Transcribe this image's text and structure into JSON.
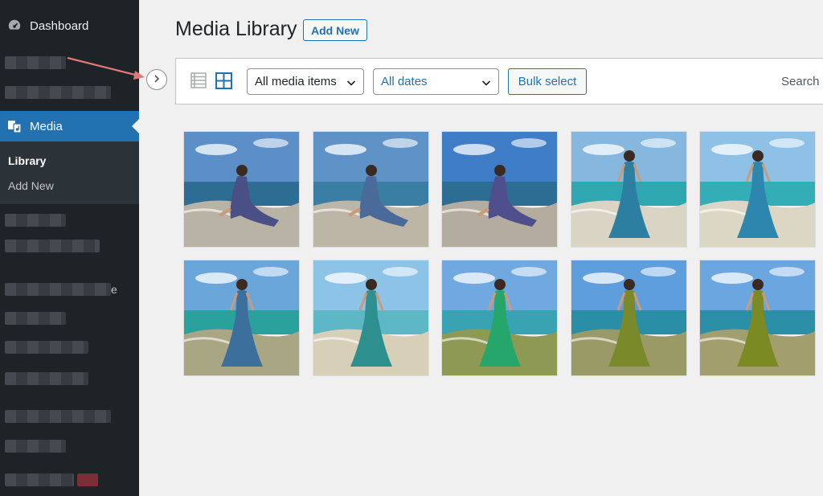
{
  "sidebar": {
    "dashboard_label": "Dashboard",
    "media_label": "Media",
    "submenu": [
      {
        "label": "Library",
        "current": true
      },
      {
        "label": "Add New",
        "current": false
      }
    ],
    "blurred_trailing_char": "e"
  },
  "header": {
    "title": "Media Library",
    "add_new_label": "Add New"
  },
  "toolbar": {
    "media_filter": "All media items",
    "date_filter": "All dates",
    "bulk_select_label": "Bulk select",
    "search_label": "Search"
  },
  "colors": {
    "admin_bar": "#1d2327",
    "accent": "#2271b1",
    "background": "#f0f0f1",
    "annotation_arrow": "#e07a7a"
  },
  "media_items": [
    {
      "dress": "#4a4f86",
      "sky": "#5c8fc7",
      "sea": "#2d6d93",
      "ground": "#b9b3a6",
      "pose": "sit"
    },
    {
      "dress": "#4a6a99",
      "sky": "#5f93c8",
      "sea": "#3a7fa3",
      "ground": "#bdb5a5",
      "pose": "sit"
    },
    {
      "dress": "#4f4f8e",
      "sky": "#3f7dc6",
      "sea": "#2d6d93",
      "ground": "#b4ad9f",
      "pose": "sit"
    },
    {
      "dress": "#2c7fa0",
      "sky": "#86b7df",
      "sea": "#2fa7b1",
      "ground": "#d9d4c4",
      "pose": "stand"
    },
    {
      "dress": "#2d86ad",
      "sky": "#8fc0e6",
      "sea": "#34aeb6",
      "ground": "#dcd6c4",
      "pose": "stand"
    },
    {
      "dress": "#3c6f9c",
      "sky": "#6aa6da",
      "sea": "#2ba19e",
      "ground": "#a8a683",
      "pose": "stand"
    },
    {
      "dress": "#2e8f8f",
      "sky": "#8ec3e8",
      "sea": "#5db7c5",
      "ground": "#d8cfb9",
      "pose": "stand"
    },
    {
      "dress": "#27a66c",
      "sky": "#6fa9df",
      "sea": "#3aa3b3",
      "ground": "#8e9a54",
      "pose": "stand"
    },
    {
      "dress": "#7a8a2a",
      "sky": "#5f9edc",
      "sea": "#2a8fa6",
      "ground": "#9a9a66",
      "pose": "stand"
    },
    {
      "dress": "#7c8a24",
      "sky": "#6ca6e0",
      "sea": "#2b8fa8",
      "ground": "#a29e6e",
      "pose": "stand"
    }
  ]
}
